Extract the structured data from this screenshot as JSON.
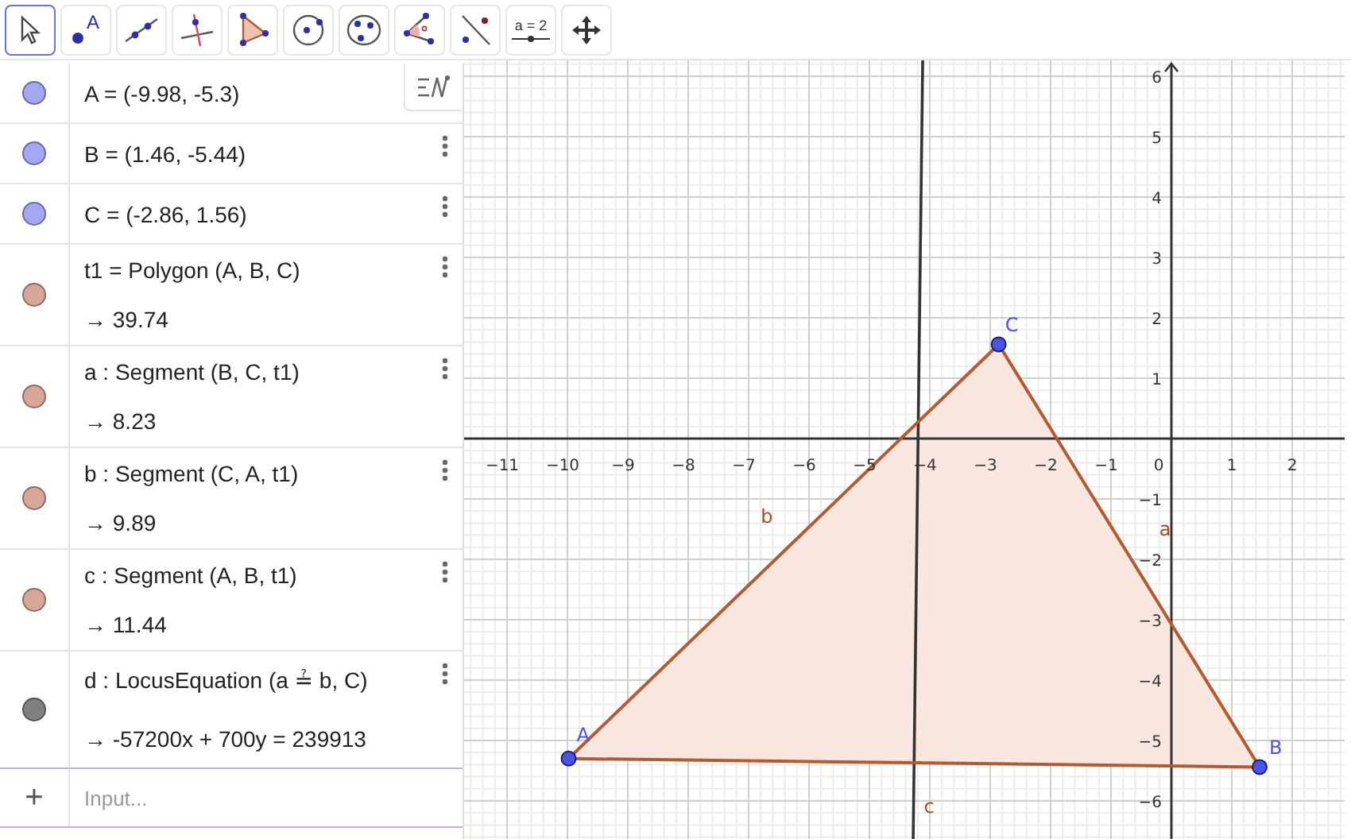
{
  "toolbar": {
    "tools": [
      {
        "kind": "move",
        "selected": true
      },
      {
        "kind": "point",
        "label": "A",
        "selected": false
      },
      {
        "kind": "line",
        "selected": false
      },
      {
        "kind": "perpendicular",
        "selected": false
      },
      {
        "kind": "polygon",
        "selected": false
      },
      {
        "kind": "circle",
        "selected": false
      },
      {
        "kind": "conic",
        "selected": false
      },
      {
        "kind": "angle",
        "selected": false
      },
      {
        "kind": "reflect",
        "selected": false
      },
      {
        "kind": "slider",
        "label": "a = 2",
        "selected": false
      },
      {
        "kind": "move-view",
        "selected": false
      }
    ]
  },
  "algebra": {
    "items": [
      {
        "kind": "point",
        "color": "#a4a7f3",
        "definition": "A = (-9.98, -5.3)"
      },
      {
        "kind": "point",
        "color": "#a4a7f3",
        "definition": "B = (1.46, -5.44)"
      },
      {
        "kind": "point",
        "color": "#a4a7f3",
        "definition": "C = (-2.86, 1.56)"
      },
      {
        "kind": "dependent",
        "color": "#d9a597",
        "definition": "t1 = Polygon (A, B, C)",
        "value": "→  39.74"
      },
      {
        "kind": "dependent",
        "color": "#d9a597",
        "definition": "a : Segment (B, C, t1)",
        "value": "→  8.23"
      },
      {
        "kind": "dependent",
        "color": "#d9a597",
        "definition": "b : Segment (C, A, t1)",
        "value": "→  9.89"
      },
      {
        "kind": "dependent",
        "color": "#d9a597",
        "definition": "c : Segment (A, B, t1)",
        "value": "→  11.44"
      },
      {
        "kind": "equation",
        "color": "#808080",
        "definition": "d : LocusEquation (a ≟ b, C)",
        "value": "→  -57200x + 700y = 239913"
      }
    ],
    "input": {
      "add_symbol": "+",
      "placeholder": "Input..."
    }
  },
  "graphics": {
    "x_ticks": [
      "−11",
      "−10",
      "−9",
      "−8",
      "−7",
      "−6",
      "−5",
      "−4",
      "−3",
      "−2",
      "−1",
      "0",
      "1",
      "2"
    ],
    "y_ticks": [
      "6",
      "5",
      "4",
      "3",
      "2",
      "1",
      "−1",
      "−2",
      "−3",
      "−4",
      "−5",
      "−6"
    ],
    "point_labels": [
      "A",
      "B",
      "C"
    ],
    "segment_labels": [
      "a",
      "b",
      "c"
    ]
  }
}
